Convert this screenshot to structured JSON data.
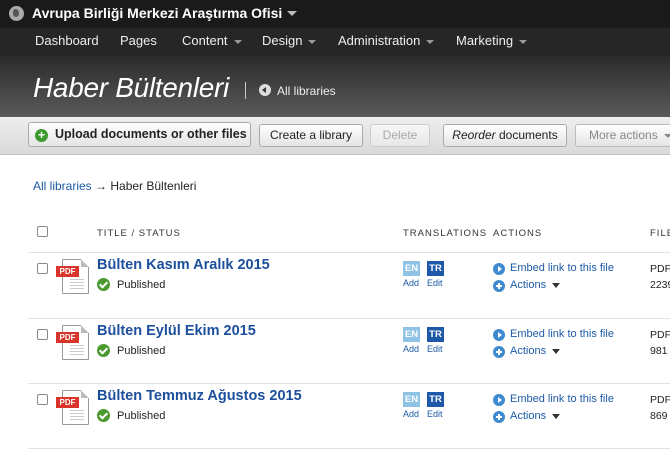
{
  "site": {
    "title": "Avrupa Birliği Merkezi Araştırma Ofisi"
  },
  "nav": [
    {
      "label": "Dashboard",
      "caret": false
    },
    {
      "label": "Pages",
      "caret": false
    },
    {
      "label": "Content",
      "caret": true
    },
    {
      "label": "Design",
      "caret": true
    },
    {
      "label": "Administration",
      "caret": true
    },
    {
      "label": "Marketing",
      "caret": true
    }
  ],
  "page": {
    "title": "Haber Bültenleri",
    "back_label": "All libraries"
  },
  "toolbar": {
    "upload_label": "Upload documents or other files",
    "create_label": "Create a library",
    "delete_label": "Delete",
    "reorder_em": "Reorder",
    "reorder_rest": " documents",
    "more_label": "More actions"
  },
  "breadcrumb": {
    "root": "All libraries",
    "sep": " → ",
    "current": "Haber Bültenleri"
  },
  "table": {
    "headers": {
      "title": "TITLE / STATUS",
      "translations": "TRANSLATIONS",
      "actions": "ACTIONS",
      "file": "FILE"
    },
    "rows": [
      {
        "title": "Bülten Kasım Aralık 2015",
        "status": "Published",
        "type": "PDF",
        "size": "2239"
      },
      {
        "title": "Bülten Eylül Ekim 2015",
        "status": "Published",
        "type": "PDF",
        "size": "981"
      },
      {
        "title": "Bülten Temmuz Ağustos 2015",
        "status": "Published",
        "type": "PDF",
        "size": "869"
      }
    ]
  },
  "row_labels": {
    "pdf_badge": "PDF",
    "lang_en": "EN",
    "lang_tr": "TR",
    "add": "Add",
    "edit": "Edit",
    "embed": "Embed link to this file",
    "actions": "Actions"
  },
  "colors": {
    "link": "#1c5aa6",
    "title": "#1c4f9c",
    "published": "#4a9a2f",
    "pdf": "#d9352b",
    "lang_en": "#8fc3e6",
    "lang_tr": "#1e58a8"
  }
}
